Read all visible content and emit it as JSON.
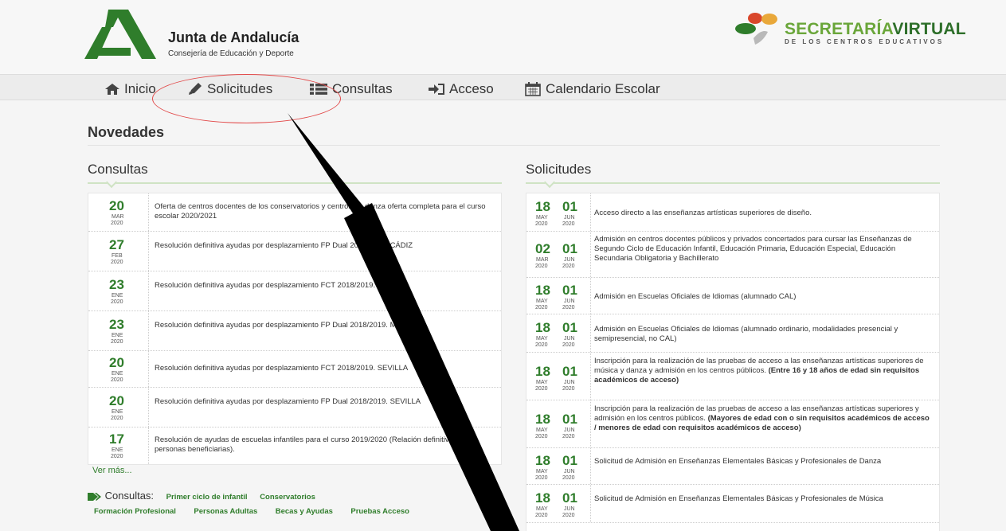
{
  "header": {
    "org_name": "Junta de Andalucía",
    "org_sub": "Consejería de Educación y Deporte",
    "sv_title_a": "SECRETARÍA",
    "sv_title_b": "VIRTUAL",
    "sv_sub": "DE LOS CENTROS EDUCATIVOS",
    "brand_green": "#2f7d2b"
  },
  "nav": {
    "items": [
      {
        "label": "Inicio",
        "icon": "home-icon"
      },
      {
        "label": "Solicitudes",
        "icon": "pencil-icon"
      },
      {
        "label": "Consultas",
        "icon": "list-icon"
      },
      {
        "label": "Acceso",
        "icon": "login-icon"
      },
      {
        "label": "Calendario Escolar",
        "icon": "calendar-icon"
      }
    ]
  },
  "main": {
    "title": "Novedades",
    "consultas": {
      "title": "Consultas",
      "items": [
        {
          "day": "20",
          "month": "MAR",
          "year": "2020",
          "text": "Oferta de centros docentes de los conservatorios y centros de danza oferta completa para el curso escolar 2020/2021"
        },
        {
          "day": "27",
          "month": "FEB",
          "year": "2020",
          "text": "Resolución definitiva ayudas por desplazamiento FP Dual 2018/2019. CÁDIZ"
        },
        {
          "day": "23",
          "month": "ENE",
          "year": "2020",
          "text": "Resolución definitiva ayudas por desplazamiento FCT 2018/2019. MÁLAGA"
        },
        {
          "day": "23",
          "month": "ENE",
          "year": "2020",
          "text": "Resolución definitiva ayudas por desplazamiento FP Dual 2018/2019. MÁLAGA"
        },
        {
          "day": "20",
          "month": "ENE",
          "year": "2020",
          "text": "Resolución definitiva ayudas por desplazamiento FCT 2018/2019. SEVILLA"
        },
        {
          "day": "20",
          "month": "ENE",
          "year": "2020",
          "text": "Resolución definitiva ayudas por desplazamiento FP Dual 2018/2019. SEVILLA"
        },
        {
          "day": "17",
          "month": "ENE",
          "year": "2020",
          "text": "Resolución de ayudas de escuelas infantiles para el curso 2019/2020 (Relación definitiva de personas beneficiarias)."
        }
      ],
      "ver_mas": "Ver más...",
      "links_label": "Consultas:",
      "links_row1": [
        "Primer ciclo de infantil",
        "Conservatorios"
      ],
      "links_row2": [
        "Formación Profesional",
        "Personas Adultas",
        "Becas y Ayudas",
        "Pruebas Acceso"
      ]
    },
    "solicitudes": {
      "title": "Solicitudes",
      "items": [
        {
          "d1": "18",
          "m1": "MAY",
          "y1": "2020",
          "d2": "01",
          "m2": "JUN",
          "y2": "2020",
          "text": "Acceso directo a las enseñanzas artísticas superiores de diseño.",
          "bold": ""
        },
        {
          "d1": "02",
          "m1": "MAR",
          "y1": "2020",
          "d2": "01",
          "m2": "JUN",
          "y2": "2020",
          "text": "Admisión en centros docentes públicos y privados concertados para cursar las Enseñanzas de Segundo Ciclo de Educación Infantil, Educación Primaria, Educación Especial, Educación Secundaria Obligatoria y Bachillerato",
          "bold": ""
        },
        {
          "d1": "18",
          "m1": "MAY",
          "y1": "2020",
          "d2": "01",
          "m2": "JUN",
          "y2": "2020",
          "text": "Admisión en Escuelas Oficiales de Idiomas (alumnado CAL)",
          "bold": ""
        },
        {
          "d1": "18",
          "m1": "MAY",
          "y1": "2020",
          "d2": "01",
          "m2": "JUN",
          "y2": "2020",
          "text": "Admisión en Escuelas Oficiales de Idiomas (alumnado ordinario, modalidades presencial y semipresencial, no CAL)",
          "bold": ""
        },
        {
          "d1": "18",
          "m1": "MAY",
          "y1": "2020",
          "d2": "01",
          "m2": "JUN",
          "y2": "2020",
          "text": "Inscripción para la realización de las pruebas de acceso a las enseñanzas artísticas superiores de música y danza y admisión en los centros públicos. ",
          "bold": "(Entre 16 y 18 años de edad sin requisitos académicos de acceso)"
        },
        {
          "d1": "18",
          "m1": "MAY",
          "y1": "2020",
          "d2": "01",
          "m2": "JUN",
          "y2": "2020",
          "text": "Inscripción para la realización de las pruebas de acceso a las enseñanzas artísticas superiores y admisión en los centros públicos. ",
          "bold": "(Mayores de edad con o sin requisitos académicos de acceso / menores de edad con requisitos académicos de acceso)"
        },
        {
          "d1": "18",
          "m1": "MAY",
          "y1": "2020",
          "d2": "01",
          "m2": "JUN",
          "y2": "2020",
          "text": "Solicitud de Admisión en Enseñanzas Elementales Básicas y Profesionales de Danza",
          "bold": ""
        },
        {
          "d1": "18",
          "m1": "MAY",
          "y1": "2020",
          "d2": "01",
          "m2": "JUN",
          "y2": "2020",
          "text": "Solicitud de Admisión en Enseñanzas Elementales Básicas y Profesionales de Música",
          "bold": ""
        }
      ]
    }
  },
  "annotation": {
    "ellipse_color": "#e24a4a",
    "arrow_color": "#000000"
  }
}
